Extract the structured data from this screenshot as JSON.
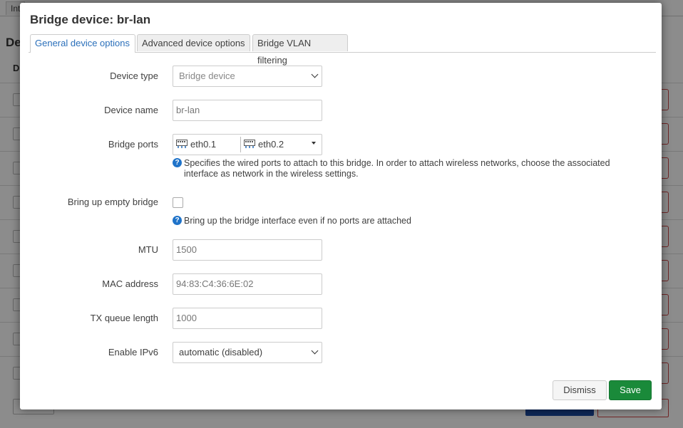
{
  "background": {
    "tab_label": "Int",
    "heading": "De",
    "column_header": "D"
  },
  "modal": {
    "title": "Bridge device: br-lan",
    "tabs": [
      {
        "label": "General device options",
        "active": true
      },
      {
        "label": "Advanced device options",
        "active": false
      },
      {
        "label": "Bridge VLAN filtering",
        "active": false
      }
    ],
    "fields": {
      "device_type": {
        "label": "Device type",
        "value": "Bridge device"
      },
      "device_name": {
        "label": "Device name",
        "value": "br-lan"
      },
      "bridge_ports": {
        "label": "Bridge ports",
        "ports": [
          "eth0.1",
          "eth0.2"
        ],
        "help": "Specifies the wired ports to attach to this bridge. In order to attach wireless networks, choose the associated interface as network in the wireless settings."
      },
      "empty_bridge": {
        "label": "Bring up empty bridge",
        "checked": false,
        "help": "Bring up the bridge interface even if no ports are attached"
      },
      "mtu": {
        "label": "MTU",
        "placeholder": "1500"
      },
      "mac": {
        "label": "MAC address",
        "placeholder": "94:83:C4:36:6E:02"
      },
      "txqueue": {
        "label": "TX queue length",
        "placeholder": "1000"
      },
      "ipv6": {
        "label": "Enable IPv6",
        "value": "automatic (disabled)"
      }
    },
    "buttons": {
      "dismiss": "Dismiss",
      "save": "Save"
    }
  },
  "colors": {
    "accent": "#2a6fba",
    "save": "#1a8a3a",
    "help_icon": "#1f73c9"
  }
}
